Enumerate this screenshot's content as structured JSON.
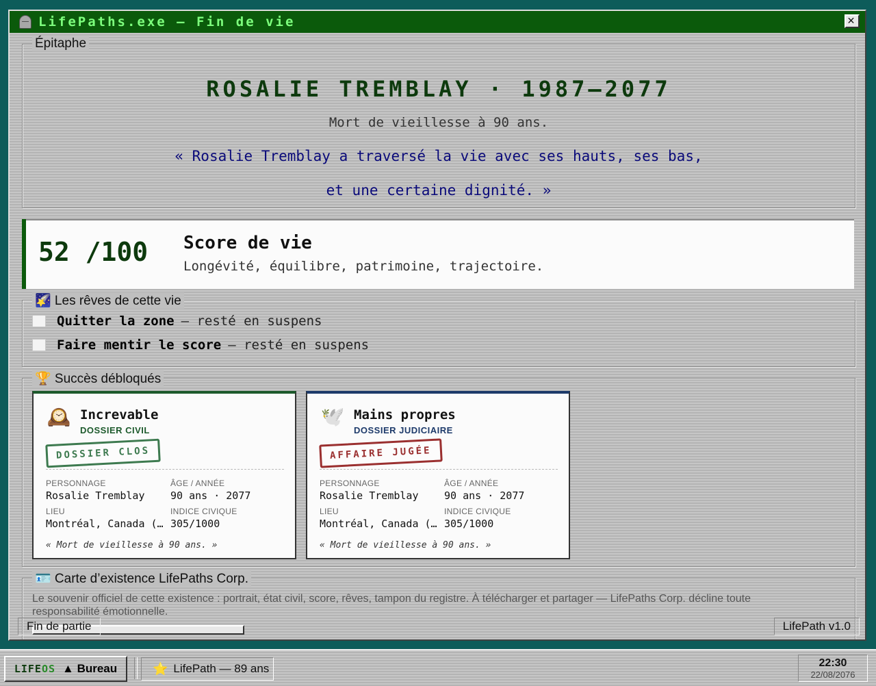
{
  "window": {
    "title": "LifePaths.exe — Fin de vie",
    "close_label": "✕"
  },
  "epitaph": {
    "legend": "Épitaphe",
    "name": "ROSALIE TREMBLAY · 1987–2077",
    "subtitle": "Mort de vieillesse à 90 ans.",
    "quote_line1": "« Rosalie Tremblay a traversé la vie avec ses hauts, ses bas,",
    "quote_line2": "et une certaine dignité. »"
  },
  "score": {
    "value": "52 /100",
    "title": "Score de vie",
    "description": "Longévité, équilibre, patrimoine, trajectoire."
  },
  "dreams": {
    "legend": "🌠 Les rêves de cette vie",
    "items": [
      {
        "title": "Quitter la zone",
        "status": "— resté en suspens"
      },
      {
        "title": "Faire mentir le score",
        "status": "— resté en suspens"
      }
    ]
  },
  "achievements": {
    "legend": "🏆 Succès débloqués",
    "cards": [
      {
        "icon": "🕰️",
        "title": "Increvable",
        "category": "DOSSIER CIVIL",
        "stamp": "DOSSIER CLOS",
        "fields": {
          "personnage_label": "PERSONNAGE",
          "personnage": "Rosalie Tremblay",
          "age_label": "ÂGE / ANNÉE",
          "age": "90 ans · 2077",
          "lieu_label": "LIEU",
          "lieu": "Montréal, Canada (…",
          "indice_label": "INDICE CIVIQUE",
          "indice": "305/1000"
        },
        "quote": "« Mort de vieillesse à 90 ans. »"
      },
      {
        "icon": "🕊️",
        "title": "Mains propres",
        "category": "DOSSIER JUDICIAIRE",
        "stamp": "AFFAIRE JUGÉE",
        "fields": {
          "personnage_label": "PERSONNAGE",
          "personnage": "Rosalie Tremblay",
          "age_label": "ÂGE / ANNÉE",
          "age": "90 ans · 2077",
          "lieu_label": "LIEU",
          "lieu": "Montréal, Canada (…",
          "indice_label": "INDICE CIVIQUE",
          "indice": "305/1000"
        },
        "quote": "« Mort de vieillesse à 90 ans. »"
      }
    ]
  },
  "carte": {
    "legend": "🪪 Carte d’existence LifePaths Corp.",
    "description": "Le souvenir officiel de cette existence : portrait, état civil, score, rêves, tampon du registre. À télécharger et partager — LifePaths Corp. décline toute responsabilité émotionnelle."
  },
  "statusbar": {
    "left": "Fin de partie",
    "right": "LifePath v1.0"
  },
  "taskbar": {
    "logo_a": "LIFE",
    "logo_b": "OS",
    "start_label": "▲ Bureau",
    "task_icon": "⭐",
    "task_label": "LifePath — 89 ans",
    "clock_time": "22:30",
    "clock_date": "22/08/2076"
  }
}
